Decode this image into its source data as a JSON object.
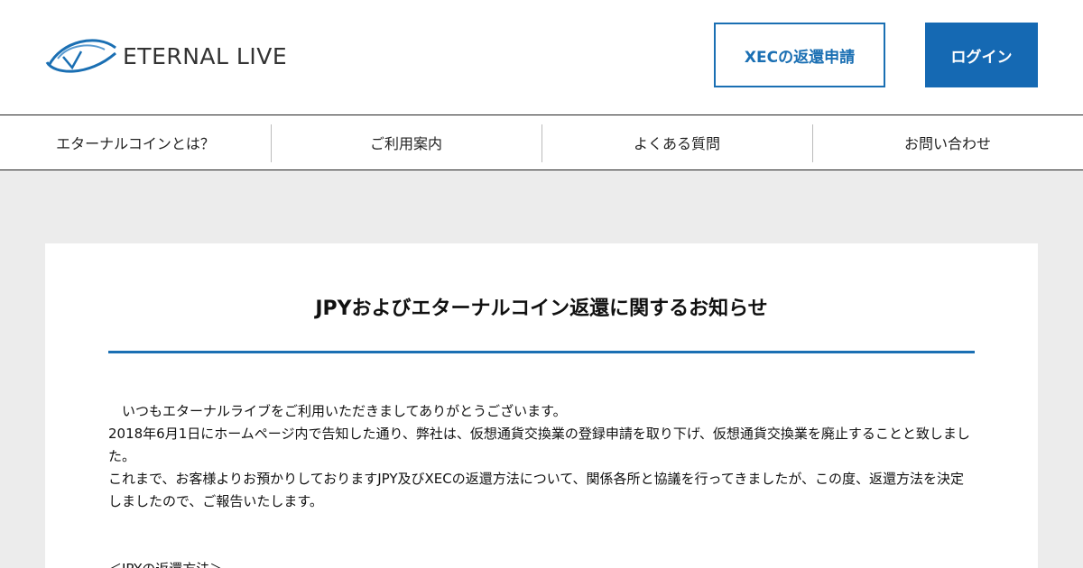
{
  "header": {
    "logo_text": "ETERNAL LIVE",
    "xec_button_label": "XECの返還申請",
    "login_button_label": "ログイン",
    "brand_color": "#1569b3"
  },
  "nav": {
    "items": [
      {
        "label": "エターナルコインとは？"
      },
      {
        "label": "ご利用案内"
      },
      {
        "label": "よくある質問"
      },
      {
        "label": "お問い合わせ"
      }
    ]
  },
  "notice": {
    "title": "JPYおよびエターナルコイン返還に関するお知らせ",
    "paragraphs": [
      "　いつもエターナルライブをご利用いただきましてありがとうございます。",
      "2018年6月1日にホームページ内で告知した通り、弊社は、仮想通貨交換業の登録申請を取り下げ、仮想通貨交換業を廃止することと致しました。",
      "これまで、お客様よりお預かりしておりますJPY及びXECの返還方法について、関係各所と協議を行ってきましたが、この度、返還方法を決定しましたので、ご報告いたします。"
    ],
    "section_heading": "＜JPYの返還方法＞"
  }
}
